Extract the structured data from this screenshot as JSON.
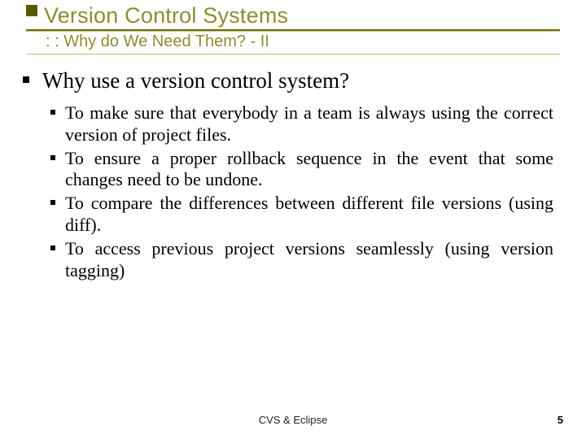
{
  "header": {
    "title": "Version Control Systems",
    "subtitle": ": : Why do We Need Them? - II"
  },
  "content": {
    "question": "Why use a version control system?",
    "bullets": [
      "To make sure that everybody in a team is always using the correct version of project files.",
      "To ensure a proper rollback sequence in the event that some changes need to be undone.",
      "To compare the differences between different file versions (using diff).",
      "To access previous project versions seamlessly (using version tagging)"
    ]
  },
  "footer": {
    "center": "CVS & Eclipse",
    "page": "5"
  }
}
